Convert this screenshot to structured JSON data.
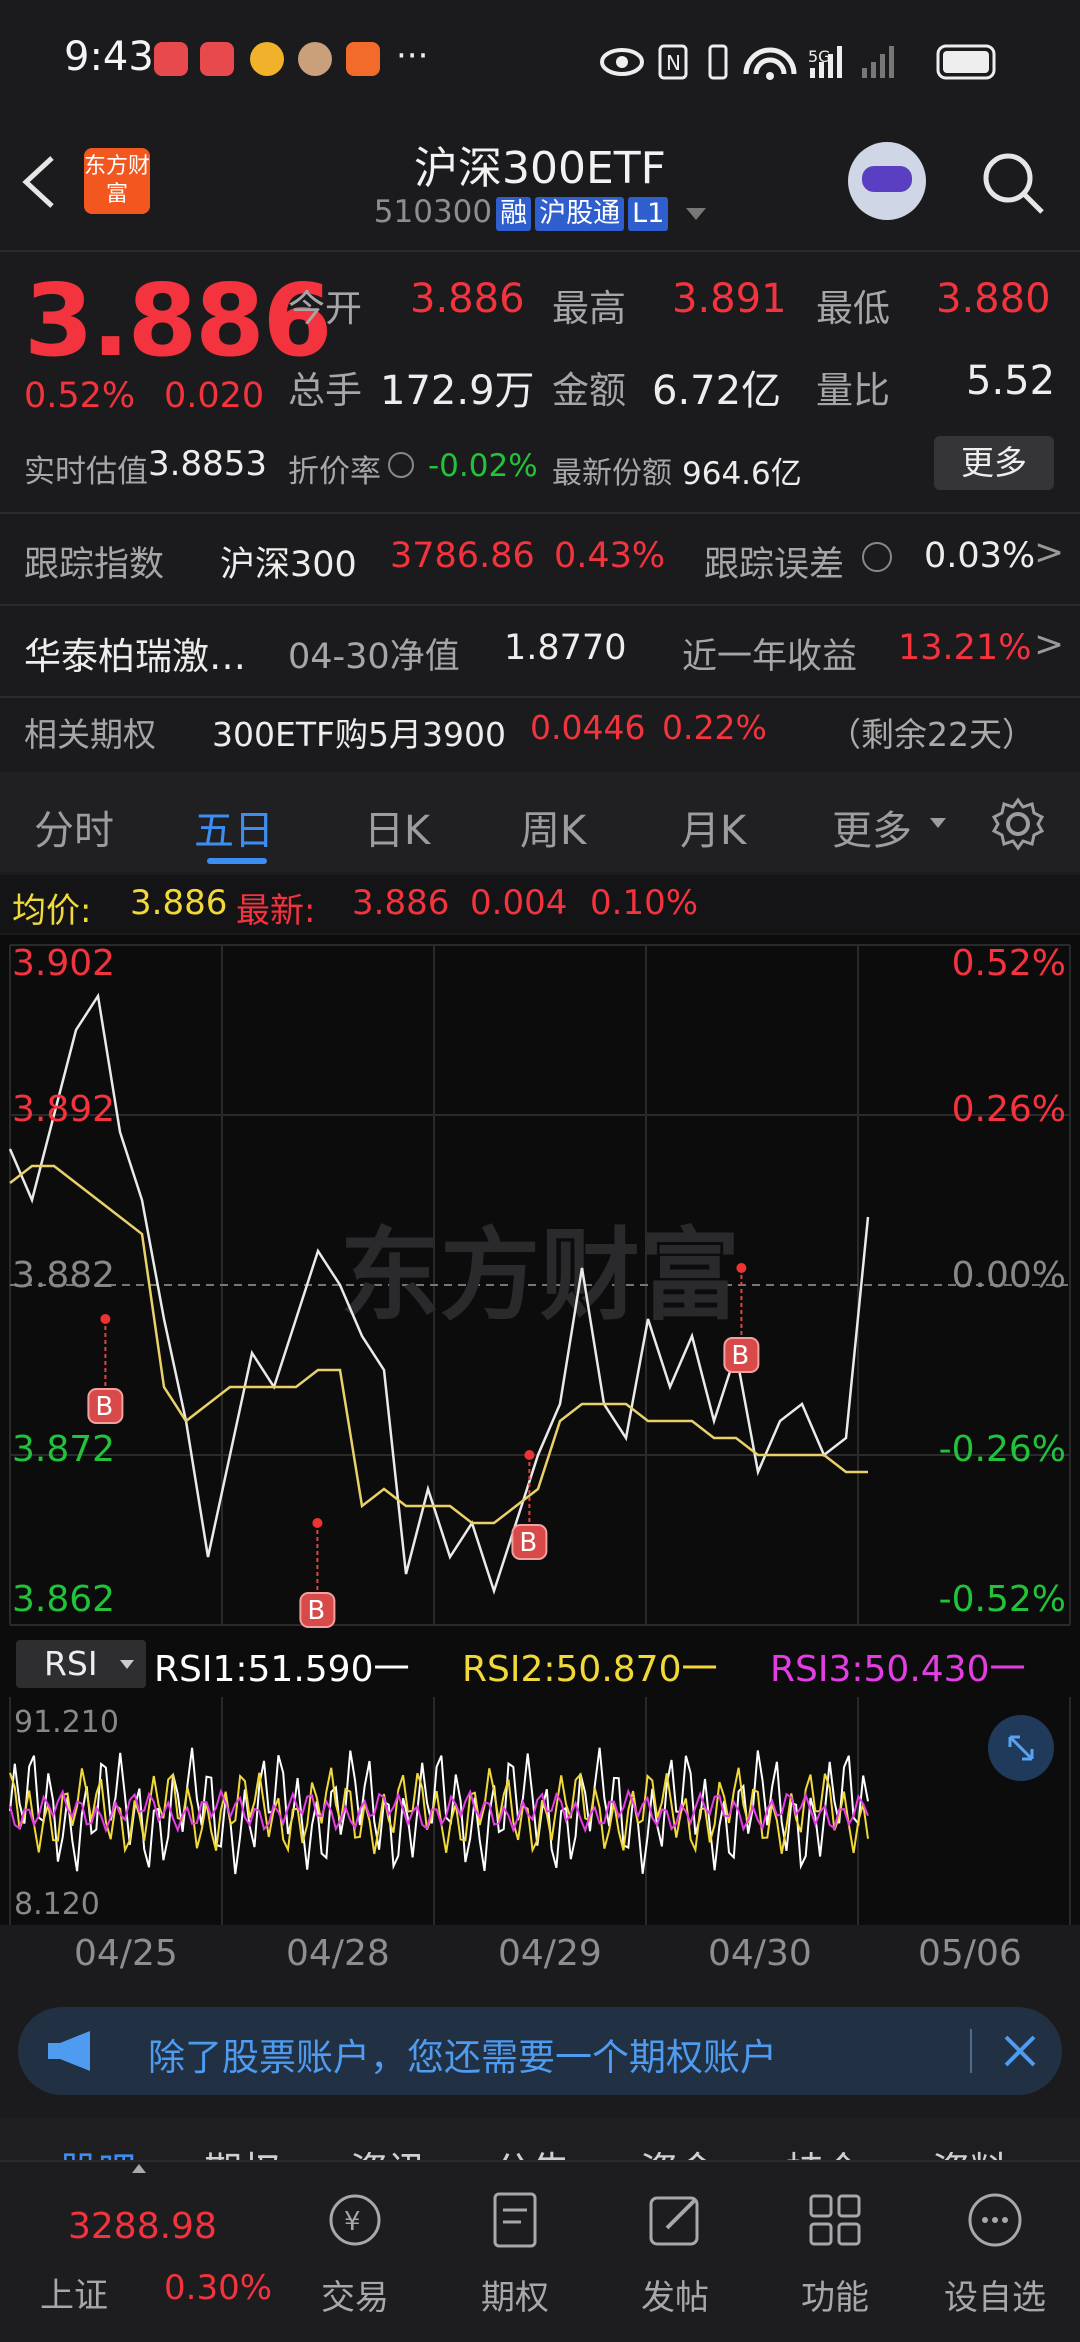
{
  "status_bar": {
    "time": "9:43",
    "more": "···",
    "network": "5G"
  },
  "header": {
    "app_logo_text": "东方财富",
    "stock_name": "沪深300ETF",
    "code": "510300",
    "tags": [
      "融",
      "沪股通",
      "L1"
    ]
  },
  "quote": {
    "price": "3.886",
    "change_pct": "0.52%",
    "change_amt": "0.020",
    "open_label": "今开",
    "open": "3.886",
    "high_label": "最高",
    "high": "3.891",
    "low_label": "最低",
    "low": "3.880",
    "volume_label": "总手",
    "volume": "172.9万",
    "amount_label": "金额",
    "amount": "6.72亿",
    "ratio_label": "量比",
    "ratio": "5.52",
    "iopv_label": "实时估值",
    "iopv": "3.8853",
    "premium_label": "折价率",
    "premium": "-0.02%",
    "shares_label": "最新份额",
    "shares": "964.6亿",
    "more_button": "更多"
  },
  "tracking": {
    "label": "跟踪指数",
    "index": "沪深300",
    "value": "3786.86",
    "pct": "0.43%",
    "error_label": "跟踪误差",
    "error": "0.03%"
  },
  "fund": {
    "name": "华泰柏瑞激…",
    "nav_label": "04-30净值",
    "nav": "1.8770",
    "yield_label": "近一年收益",
    "yield": "13.21%"
  },
  "options": {
    "label": "相关期权",
    "name": "300ETF购5月3900",
    "price": "0.0446",
    "pct": "0.22%",
    "remain": "（剩余22天）"
  },
  "tabs": [
    "分时",
    "五日",
    "日K",
    "周K",
    "月K",
    "更多"
  ],
  "active_tab": "五日",
  "info_line": {
    "avg_label": "均价:",
    "avg": "3.886",
    "latest_label": "最新:",
    "latest": "3.886",
    "chg": "0.004",
    "chg_pct": "0.10%"
  },
  "chart_data": {
    "type": "line",
    "title": "",
    "y_ticks_left": [
      "3.902",
      "3.892",
      "3.882",
      "3.872",
      "3.862"
    ],
    "y_ticks_right": [
      "0.52%",
      "0.26%",
      "0.00%",
      "-0.26%",
      "-0.52%"
    ],
    "ylim": [
      3.862,
      3.902
    ],
    "x_dates": [
      "04/25",
      "04/28",
      "04/29",
      "04/30",
      "05/06"
    ],
    "series": [
      {
        "values": [
          3.89,
          3.887,
          3.892,
          3.897,
          3.899,
          3.891,
          3.887,
          3.88,
          3.874,
          3.866,
          3.872,
          3.878,
          3.876,
          3.88,
          3.884,
          3.882,
          3.879,
          3.877,
          3.865,
          3.87,
          3.866,
          3.868,
          3.864,
          3.868,
          3.872,
          3.875,
          3.883,
          3.875,
          3.873,
          3.88,
          3.876,
          3.879,
          3.874,
          3.878,
          3.871,
          3.874,
          3.875,
          3.872,
          3.873,
          3.886
        ]
      },
      {
        "values": [
          3.888,
          3.889,
          3.889,
          3.888,
          3.887,
          3.886,
          3.885,
          3.876,
          3.874,
          3.875,
          3.876,
          3.876,
          3.876,
          3.876,
          3.877,
          3.877,
          3.869,
          3.87,
          3.869,
          3.869,
          3.869,
          3.868,
          3.868,
          3.869,
          3.87,
          3.874,
          3.875,
          3.875,
          3.875,
          3.874,
          3.874,
          3.874,
          3.873,
          3.873,
          3.872,
          3.872,
          3.872,
          3.872,
          3.871,
          3.871
        ]
      }
    ],
    "b_markers": [
      {
        "day": 1,
        "price": 3.88
      },
      {
        "day": 2,
        "price": 3.868
      },
      {
        "day": 3,
        "price": 3.872
      },
      {
        "day": 4,
        "price": 3.883
      }
    ],
    "watermark": "东方财富"
  },
  "rsi": {
    "selector": "RSI",
    "rsi1": "RSI1:51.590一",
    "rsi2": "RSI2:50.870一",
    "rsi3": "RSI3:50.430一",
    "ymax": "91.210",
    "ymin": "8.120",
    "colors": {
      "rsi1": "#ffffff",
      "rsi2": "#f1d93a",
      "rsi3": "#e43de4"
    }
  },
  "banner": {
    "text": "除了股票账户，您还需要一个期权账户"
  },
  "content_tabs": [
    "股吧",
    "期权",
    "资讯",
    "公告",
    "资金",
    "持仓",
    "资料"
  ],
  "bottom_nav": {
    "index_name": "上证",
    "index_value": "3288.98",
    "index_pct": "0.30%",
    "items": [
      {
        "label": "交易",
        "icon": "trade-icon"
      },
      {
        "label": "期权",
        "icon": "option-icon"
      },
      {
        "label": "发帖",
        "icon": "post-icon"
      },
      {
        "label": "功能",
        "icon": "grid-icon"
      },
      {
        "label": "设自选",
        "icon": "add-watchlist-icon"
      }
    ]
  }
}
